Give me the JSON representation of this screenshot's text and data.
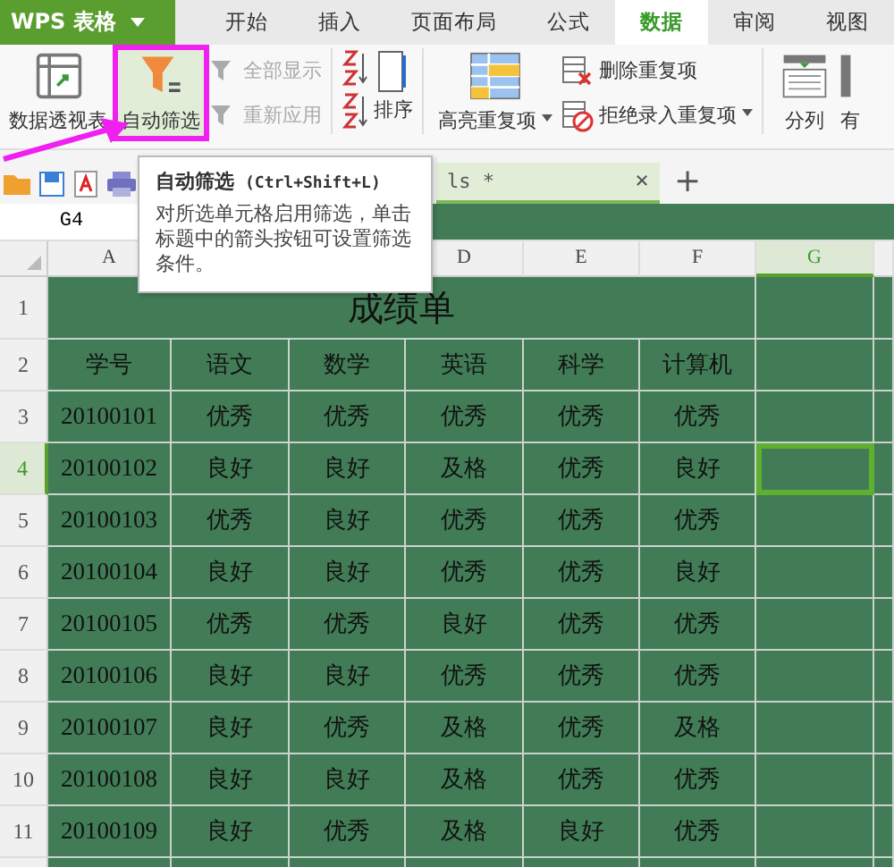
{
  "app": {
    "name": "WPS 表格"
  },
  "tabs": [
    {
      "label": "开始",
      "selected": false
    },
    {
      "label": "插入",
      "selected": false
    },
    {
      "label": "页面布局",
      "selected": false
    },
    {
      "label": "公式",
      "selected": false
    },
    {
      "label": "数据",
      "selected": true
    },
    {
      "label": "审阅",
      "selected": false
    },
    {
      "label": "视图",
      "selected": false
    }
  ],
  "ribbon": {
    "pivot": {
      "label": "数据透视表"
    },
    "autofilter": {
      "label": "自动筛选",
      "highlighted": true
    },
    "filter_small": [
      {
        "label": "全部显示",
        "disabled": true
      },
      {
        "label": "重新应用",
        "disabled": true
      }
    ],
    "sort": {
      "label": "排序"
    },
    "highlight_dup": {
      "label": "高亮重复项",
      "dropdown": true
    },
    "dup_small": [
      {
        "label": "删除重复项",
        "kind": "remove",
        "dropdown": false
      },
      {
        "label": "拒绝录入重复项",
        "kind": "reject",
        "dropdown": true
      }
    ],
    "split": {
      "label": "分列"
    },
    "cut_item": {
      "label": "有"
    }
  },
  "document_tab": {
    "label": "ls *",
    "close": "×"
  },
  "new_tab": "+",
  "name_box": "G4",
  "tooltip": {
    "title": "自动筛选",
    "shortcut": "(Ctrl+Shift+L)",
    "body": "对所选单元格启用筛选，单击标题中的箭头按钮可设置筛选条件。"
  },
  "sheet": {
    "columns": [
      {
        "label": "A",
        "selected": false
      },
      {},
      {},
      {
        "label": "D",
        "selected": false
      },
      {
        "label": "E",
        "selected": false
      },
      {
        "label": "F",
        "selected": false
      },
      {
        "label": "G",
        "selected": true
      }
    ],
    "row_numbers": [
      {
        "label": "1",
        "selected": false
      },
      {
        "label": "2",
        "selected": false
      },
      {
        "label": "3",
        "selected": false
      },
      {
        "label": "4",
        "selected": true
      },
      {
        "label": "5",
        "selected": false
      },
      {
        "label": "6",
        "selected": false
      },
      {
        "label": "7",
        "selected": false
      },
      {
        "label": "8",
        "selected": false
      },
      {
        "label": "9",
        "selected": false
      },
      {
        "label": "10",
        "selected": false
      },
      {
        "label": "11",
        "selected": false
      }
    ],
    "title": "成绩单",
    "headers": [
      "学号",
      "语文",
      "数学",
      "英语",
      "科学",
      "计算机"
    ],
    "records": [
      [
        "20100101",
        "优秀",
        "优秀",
        "优秀",
        "优秀",
        "优秀"
      ],
      [
        "20100102",
        "良好",
        "良好",
        "及格",
        "优秀",
        "良好"
      ],
      [
        "20100103",
        "优秀",
        "良好",
        "优秀",
        "优秀",
        "优秀"
      ],
      [
        "20100104",
        "良好",
        "良好",
        "优秀",
        "优秀",
        "良好"
      ],
      [
        "20100105",
        "优秀",
        "优秀",
        "良好",
        "优秀",
        "优秀"
      ],
      [
        "20100106",
        "良好",
        "良好",
        "优秀",
        "优秀",
        "优秀"
      ],
      [
        "20100107",
        "良好",
        "优秀",
        "及格",
        "优秀",
        "及格"
      ],
      [
        "20100108",
        "良好",
        "良好",
        "及格",
        "优秀",
        "优秀"
      ],
      [
        "20100109",
        "良好",
        "优秀",
        "及格",
        "良好",
        "优秀"
      ]
    ]
  }
}
